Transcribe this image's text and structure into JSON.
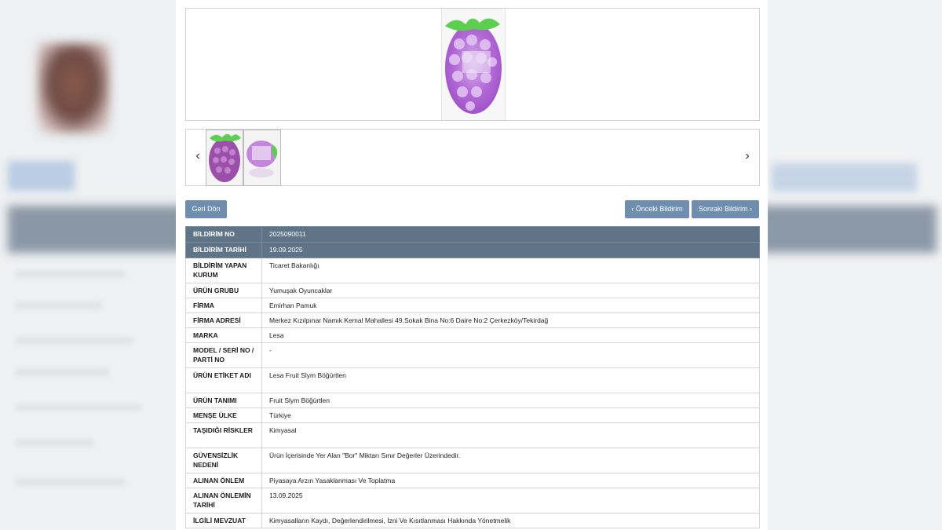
{
  "nav": {
    "back_label": "Geri Dön",
    "prev_label": "‹ Önceki Bildirim",
    "next_label": "Sonraki Bildirim ›",
    "carousel_prev": "‹",
    "carousel_next": "›"
  },
  "details": [
    {
      "key": "BİLDİRİM NO",
      "value": "2025090011"
    },
    {
      "key": "BİLDİRİM TARİHİ",
      "value": "19.09.2025"
    },
    {
      "key": "BİLDİRİM YAPAN KURUM",
      "value": "Ticaret Bakanlığı"
    },
    {
      "key": "ÜRÜN GRUBU",
      "value": "Yumuşak Oyuncaklar"
    },
    {
      "key": "FİRMA",
      "value": "Emirhan Pamuk"
    },
    {
      "key": "FİRMA ADRESİ",
      "value": "Merkez Kızılpınar Namık Kemal Mahallesi 49.Sokak Bina No:6 Daire No:2 Çerkezköy/Tekirdağ"
    },
    {
      "key": "MARKA",
      "value": "Lesa"
    },
    {
      "key": "MODEL / SERİ NO / PARTİ NO",
      "value": "-"
    },
    {
      "key": "ÜRÜN ETİKET ADI",
      "value": "Lesa Fruit Slym Böğürtlen"
    },
    {
      "key": "ÜRÜN TANIMI",
      "value": "Fruit Slym Böğürtlen"
    },
    {
      "key": "MENŞE ÜLKE",
      "value": "Türkiye"
    },
    {
      "key": "TAŞIDIĞI RİSKLER",
      "value": "Kimyasal"
    },
    {
      "key": "GÜVENSİZLİK NEDENİ",
      "value": "Ürün İçerisinde Yer Alan \"Bor\" Miktarı Sınır Değerler Üzerindedir."
    },
    {
      "key": "ALINAN ÖNLEM",
      "value": "Piyasaya Arzın Yasaklanması Ve Toplatma"
    },
    {
      "key": "ALINAN ÖNLEMİN TARİHİ",
      "value": "13.09.2025"
    },
    {
      "key": "İLGİLİ MEVZUAT",
      "value": "Kimyasalların Kaydı, Değerlendirilmesi, İzni Ve Kısıtlanması Hakkında Yönetmelik"
    }
  ],
  "colors": {
    "header_row": "#5f7587",
    "button": "#6f8eaf",
    "product_purple": "#b36ad6",
    "leaf_green": "#5ccf4e"
  },
  "icons": {
    "product_photo": "blackberry-slime-photo",
    "thumbnail": "product-thumbnail"
  }
}
